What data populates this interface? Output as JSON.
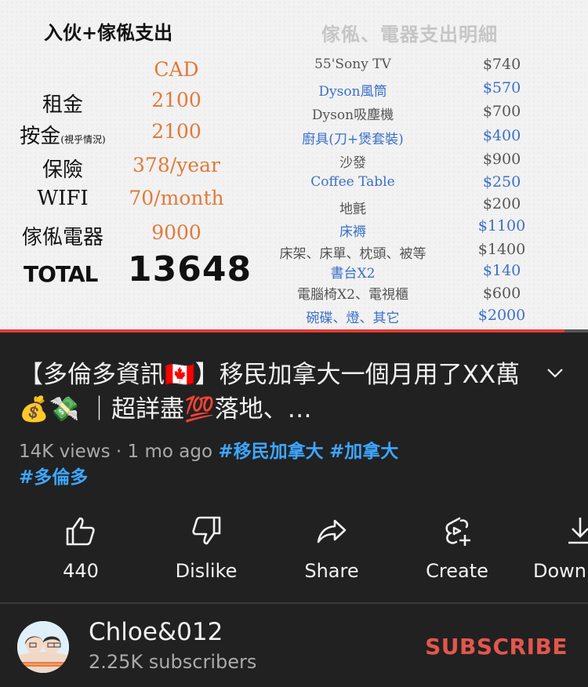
{
  "thumbnail": {
    "left_title": "入伙+傢俬支出",
    "right_title": "傢俬、電器支出明細",
    "currency": "CAD",
    "rows": [
      {
        "label": "租金",
        "value": "2100"
      },
      {
        "label": "按金",
        "note": "(視乎情況)",
        "value": "2100"
      },
      {
        "label": "保險",
        "value": "378/year"
      },
      {
        "label": "WIFI",
        "value": "70/month"
      },
      {
        "label": "傢俬電器",
        "value": "9000"
      }
    ],
    "total_label": "TOTAL",
    "total_value": "13648",
    "items": [
      {
        "name": "55'Sony TV",
        "price": "$740",
        "color": "gray"
      },
      {
        "name": "Dyson風筒",
        "price": "$570",
        "color": "blue"
      },
      {
        "name": "Dyson吸塵機",
        "price": "$700",
        "color": "gray"
      },
      {
        "name": "廚具(刀+煲套裝)",
        "price": "$400",
        "color": "blue"
      },
      {
        "name": "沙發",
        "price": "$900",
        "color": "gray"
      },
      {
        "name": "Coffee Table",
        "price": "$250",
        "color": "blue"
      },
      {
        "name": "地氈",
        "price": "$200",
        "color": "gray"
      },
      {
        "name": "床褥",
        "price": "$1100",
        "color": "blue"
      },
      {
        "name": "床架、床單、枕頭、被等",
        "price": "$1400",
        "color": "gray"
      },
      {
        "name": "書台X2",
        "price": "$140",
        "color": "blue"
      },
      {
        "name": "電腦椅X2、電視櫃",
        "price": "$600",
        "color": "gray"
      },
      {
        "name": "碗碟、燈、其它",
        "price": "$2000",
        "color": "blue"
      }
    ],
    "progress_fraction": 0.96
  },
  "video": {
    "title": "【多倫多資訊🇨🇦】移民加拿大一個月用了XX萬💰💸 ｜超詳盡💯落地、…",
    "views": "14K views",
    "age": "1 mo ago",
    "hashtags": [
      "#移民加拿大",
      "#加拿大",
      "#多倫多"
    ]
  },
  "actions": {
    "like_count": "440",
    "dislike": "Dislike",
    "share": "Share",
    "create": "Create",
    "download": "Download"
  },
  "channel": {
    "name": "Chloe&012",
    "subscribers": "2.25K subscribers",
    "avatar_text": "Chloe&012",
    "subscribe_label": "SUBSCRIBE"
  },
  "colors": {
    "background": "#212121",
    "subscribe": "#e2574c",
    "hashtag": "#3ea6ff",
    "progress": "#e53935",
    "thumb_orange": "#e07a3a",
    "thumb_blue": "#3a6fc8"
  }
}
